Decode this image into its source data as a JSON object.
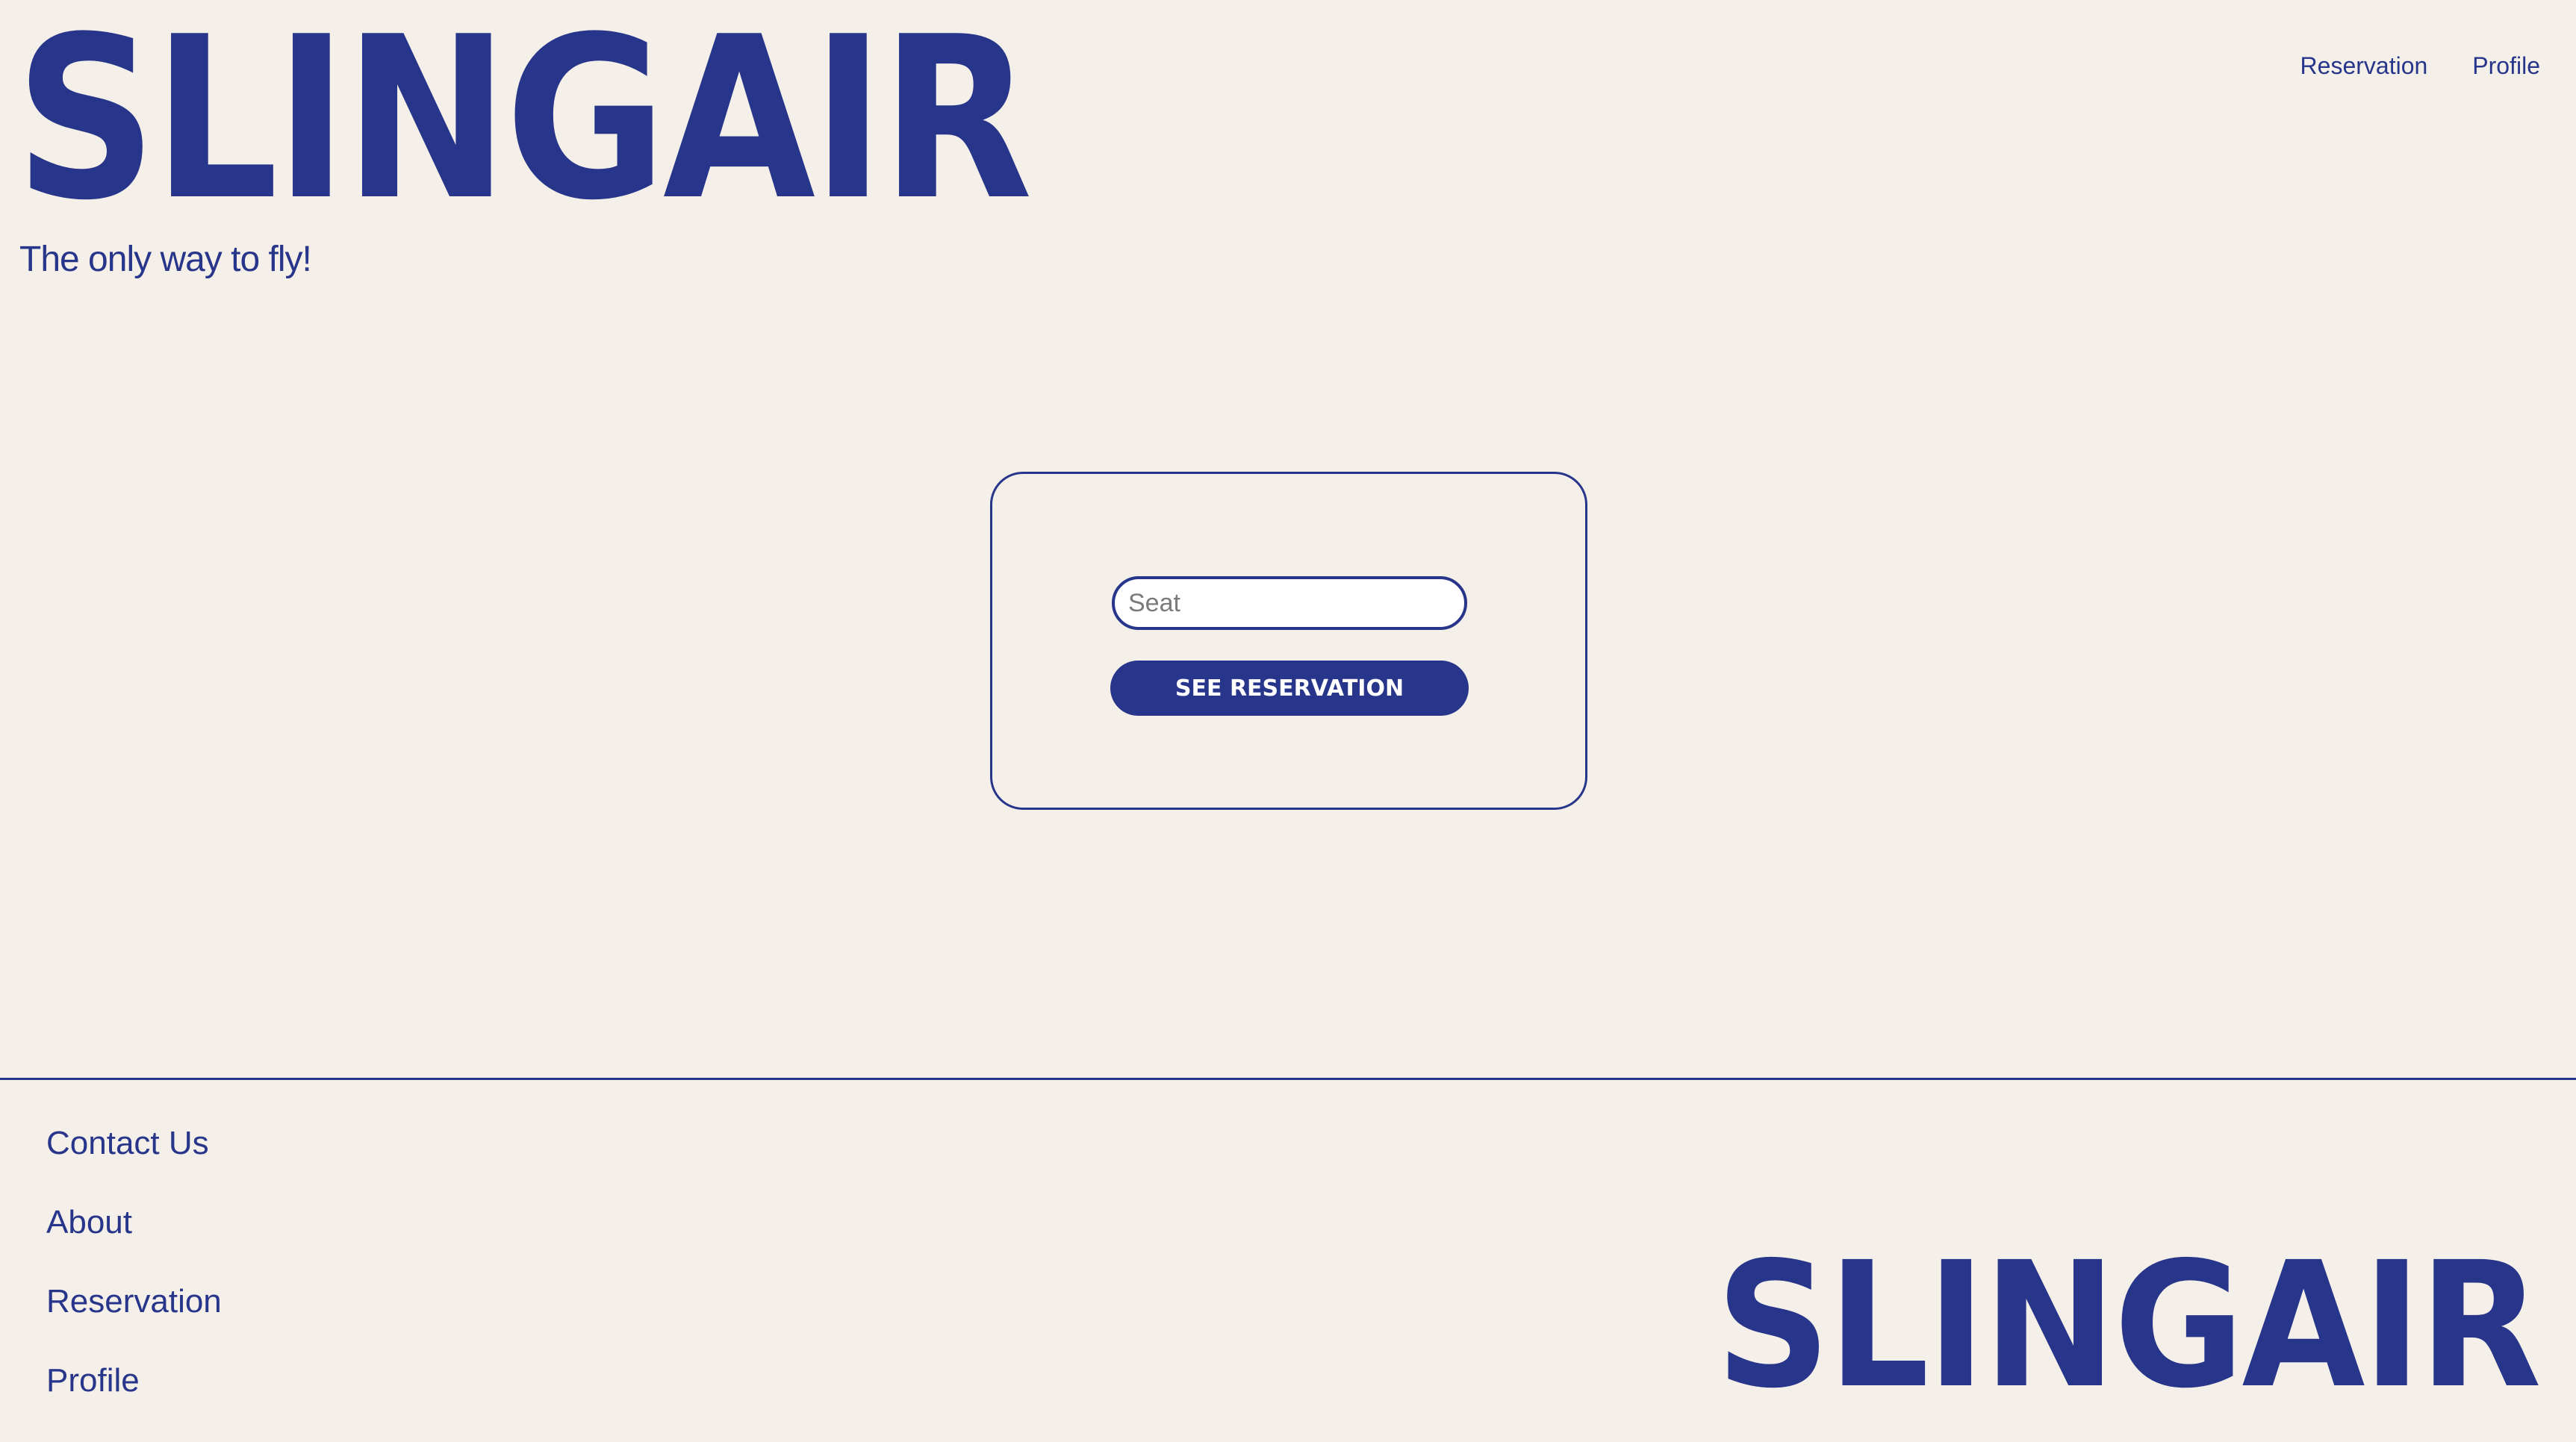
{
  "brand": {
    "logo_text": "SLINGAIR",
    "tagline": "The only way to fly!",
    "color": "#27358a",
    "background": "#f4f0e9"
  },
  "top_nav": {
    "items": [
      {
        "label": "Reservation"
      },
      {
        "label": "Profile"
      }
    ]
  },
  "reservation_form": {
    "seat_input": {
      "value": "",
      "placeholder": "Seat"
    },
    "submit_label": "SEE RESERVATION"
  },
  "footer": {
    "links": [
      {
        "label": "Contact Us"
      },
      {
        "label": "About"
      },
      {
        "label": "Reservation"
      },
      {
        "label": "Profile"
      }
    ],
    "logo_text": "SLINGAIR"
  }
}
